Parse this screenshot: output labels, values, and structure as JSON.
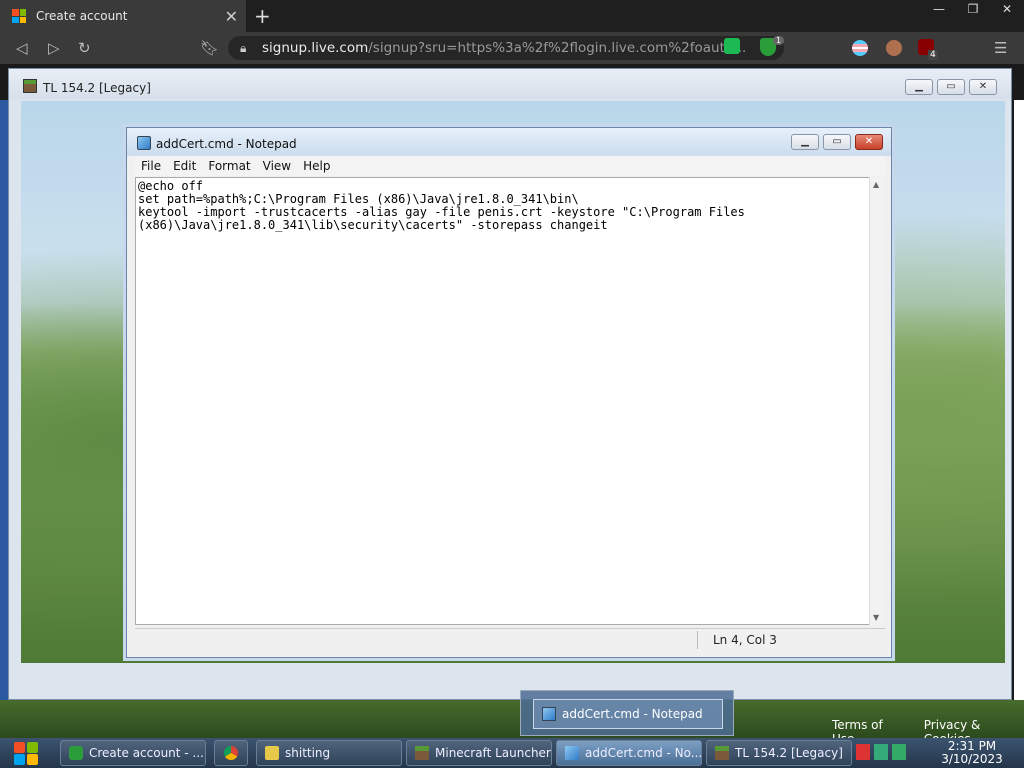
{
  "browser": {
    "tab_title": "Create account",
    "url_host": "signup.live.com",
    "url_rest": "/signup?sru=https%3a%2f%2flogin.live.com%2foauth...",
    "extension_badge_1": "1",
    "extension_badge_2": "4"
  },
  "tl_window": {
    "title": "TL 154.2  [Legacy]"
  },
  "notepad": {
    "title": "addCert.cmd - Notepad",
    "menu": [
      "File",
      "Edit",
      "Format",
      "View",
      "Help"
    ],
    "content": "@echo off\nset path=%path%;C:\\Program Files (x86)\\Java\\jre1.8.0_341\\bin\\\nkeytool -import -trustcacerts -alias gay -file penis.crt -keystore \"C:\\Program Files\n(x86)\\Java\\jre1.8.0_341\\lib\\security\\cacerts\" -storepass changeit",
    "status_position": "Ln 4, Col 3"
  },
  "footer": {
    "terms": "Terms of Use",
    "privacy": "Privacy & Cookies"
  },
  "taskbar": {
    "items": [
      {
        "label": "Create account - ..."
      },
      {
        "label": ""
      },
      {
        "label": "shitting"
      },
      {
        "label": "Minecraft Launcher"
      },
      {
        "label": "addCert.cmd - No..."
      },
      {
        "label": "TL 154.2  [Legacy]"
      }
    ],
    "preview_label": "addCert.cmd - Notepad",
    "time": "2:31 PM",
    "date": "3/10/2023"
  },
  "colors": {
    "taskbar": "#24364a",
    "accent": "#2f7bc8"
  }
}
